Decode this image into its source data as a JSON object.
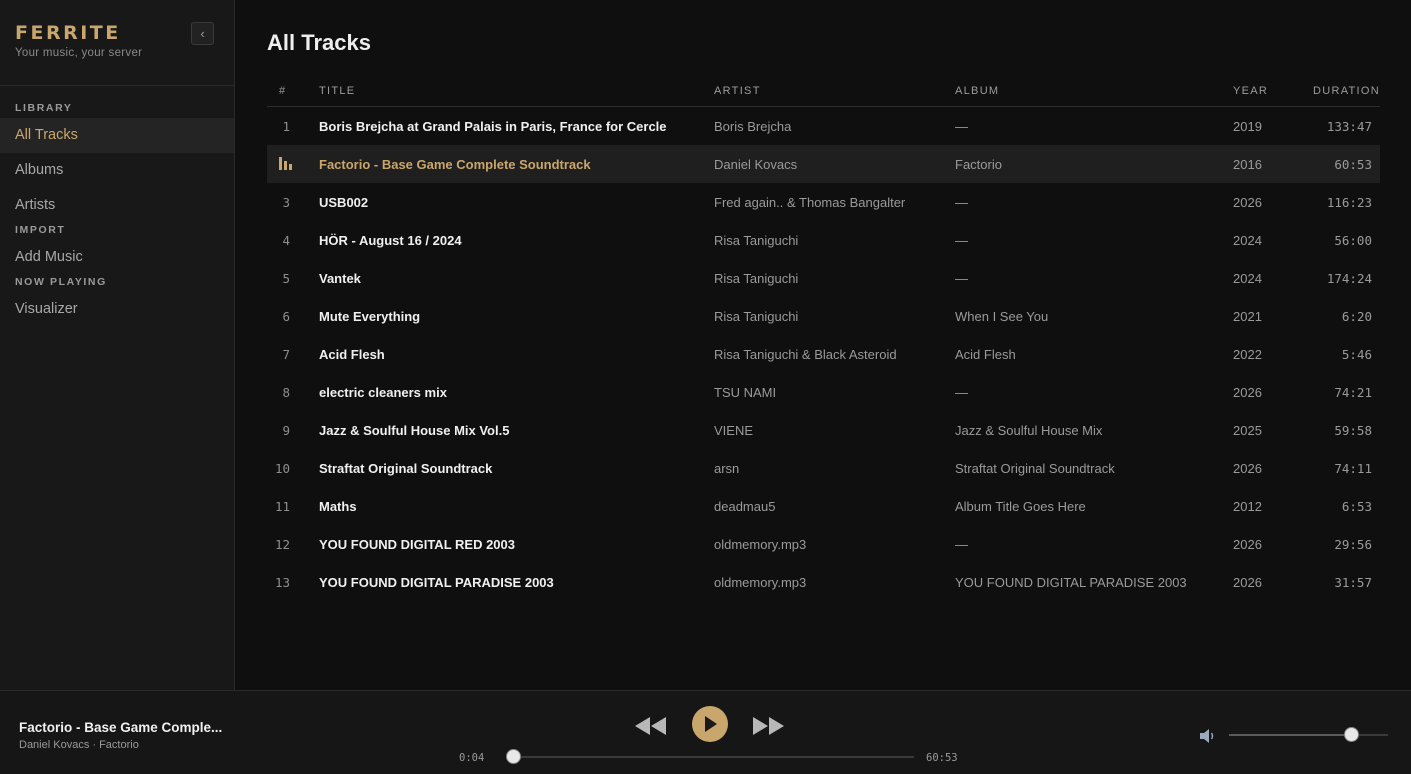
{
  "brand": {
    "name": "FERRITE",
    "tagline": "Your music, your server",
    "collapse_glyph": "‹"
  },
  "sidebar": {
    "sections": [
      {
        "label": "LIBRARY",
        "items": [
          "All Tracks",
          "Albums",
          "Artists"
        ]
      },
      {
        "label": "IMPORT",
        "items": [
          "Add Music"
        ]
      },
      {
        "label": "NOW PLAYING",
        "items": [
          "Visualizer"
        ]
      }
    ],
    "active_item": "All Tracks"
  },
  "main": {
    "title": "All Tracks",
    "columns": {
      "num": "#",
      "title": "TITLE",
      "artist": "ARTIST",
      "album": "ALBUM",
      "year": "YEAR",
      "duration": "DURATION"
    },
    "playing_index": 2,
    "tracks": [
      {
        "num": "1",
        "title": "Boris Brejcha at Grand Palais in Paris, France for Cercle",
        "artist": "Boris Brejcha",
        "album": "—",
        "year": "2019",
        "duration": "133:47"
      },
      {
        "num": "2",
        "title": "Factorio - Base Game Complete Soundtrack",
        "artist": "Daniel Kovacs",
        "album": "Factorio",
        "year": "2016",
        "duration": "60:53"
      },
      {
        "num": "3",
        "title": "USB002",
        "artist": "Fred again.. & Thomas Bangalter",
        "album": "—",
        "year": "2026",
        "duration": "116:23"
      },
      {
        "num": "4",
        "title": "HÖR - August 16 / 2024",
        "artist": "Risa Taniguchi",
        "album": "—",
        "year": "2024",
        "duration": "56:00"
      },
      {
        "num": "5",
        "title": "Vantek",
        "artist": "Risa Taniguchi",
        "album": "—",
        "year": "2024",
        "duration": "174:24"
      },
      {
        "num": "6",
        "title": "Mute Everything",
        "artist": "Risa Taniguchi",
        "album": "When I See You",
        "year": "2021",
        "duration": "6:20"
      },
      {
        "num": "7",
        "title": "Acid Flesh",
        "artist": "Risa Taniguchi & Black Asteroid",
        "album": "Acid Flesh",
        "year": "2022",
        "duration": "5:46"
      },
      {
        "num": "8",
        "title": "electric cleaners mix",
        "artist": "TSU NAMI",
        "album": "—",
        "year": "2026",
        "duration": "74:21"
      },
      {
        "num": "9",
        "title": "Jazz & Soulful House Mix Vol.5",
        "artist": "VIENE",
        "album": "Jazz & Soulful House Mix",
        "year": "2025",
        "duration": "59:58"
      },
      {
        "num": "10",
        "title": "Straftat Original Soundtrack",
        "artist": "arsn",
        "album": "Straftat Original Soundtrack",
        "year": "2026",
        "duration": "74:11"
      },
      {
        "num": "11",
        "title": "Maths",
        "artist": "deadmau5",
        "album": "Album Title Goes Here",
        "year": "2012",
        "duration": "6:53"
      },
      {
        "num": "12",
        "title": "YOU FOUND DIGITAL RED 2003",
        "artist": "oldmemory.mp3",
        "album": "—",
        "year": "2026",
        "duration": "29:56"
      },
      {
        "num": "13",
        "title": "YOU FOUND DIGITAL PARADISE 2003",
        "artist": "oldmemory.mp3",
        "album": "YOU FOUND DIGITAL PARADISE 2003",
        "year": "2026",
        "duration": "31:57"
      }
    ]
  },
  "player": {
    "title": "Factorio - Base Game Comple...",
    "subtitle": "Daniel Kovacs · Factorio",
    "current_time": "0:04",
    "total_time": "60:53",
    "progress_fraction": 0.0011,
    "volume_fraction": 0.77,
    "icons": {
      "prev": "skip-back-icon",
      "play": "play-icon",
      "next": "skip-forward-icon",
      "volume": "speaker-icon",
      "now_playing": "equalizer-icon"
    }
  },
  "colors": {
    "accent": "#c9a66b",
    "background": "#0f0f0f",
    "sidebar": "#181818",
    "text": "#e8e8e8",
    "muted": "#9a9a9a"
  }
}
